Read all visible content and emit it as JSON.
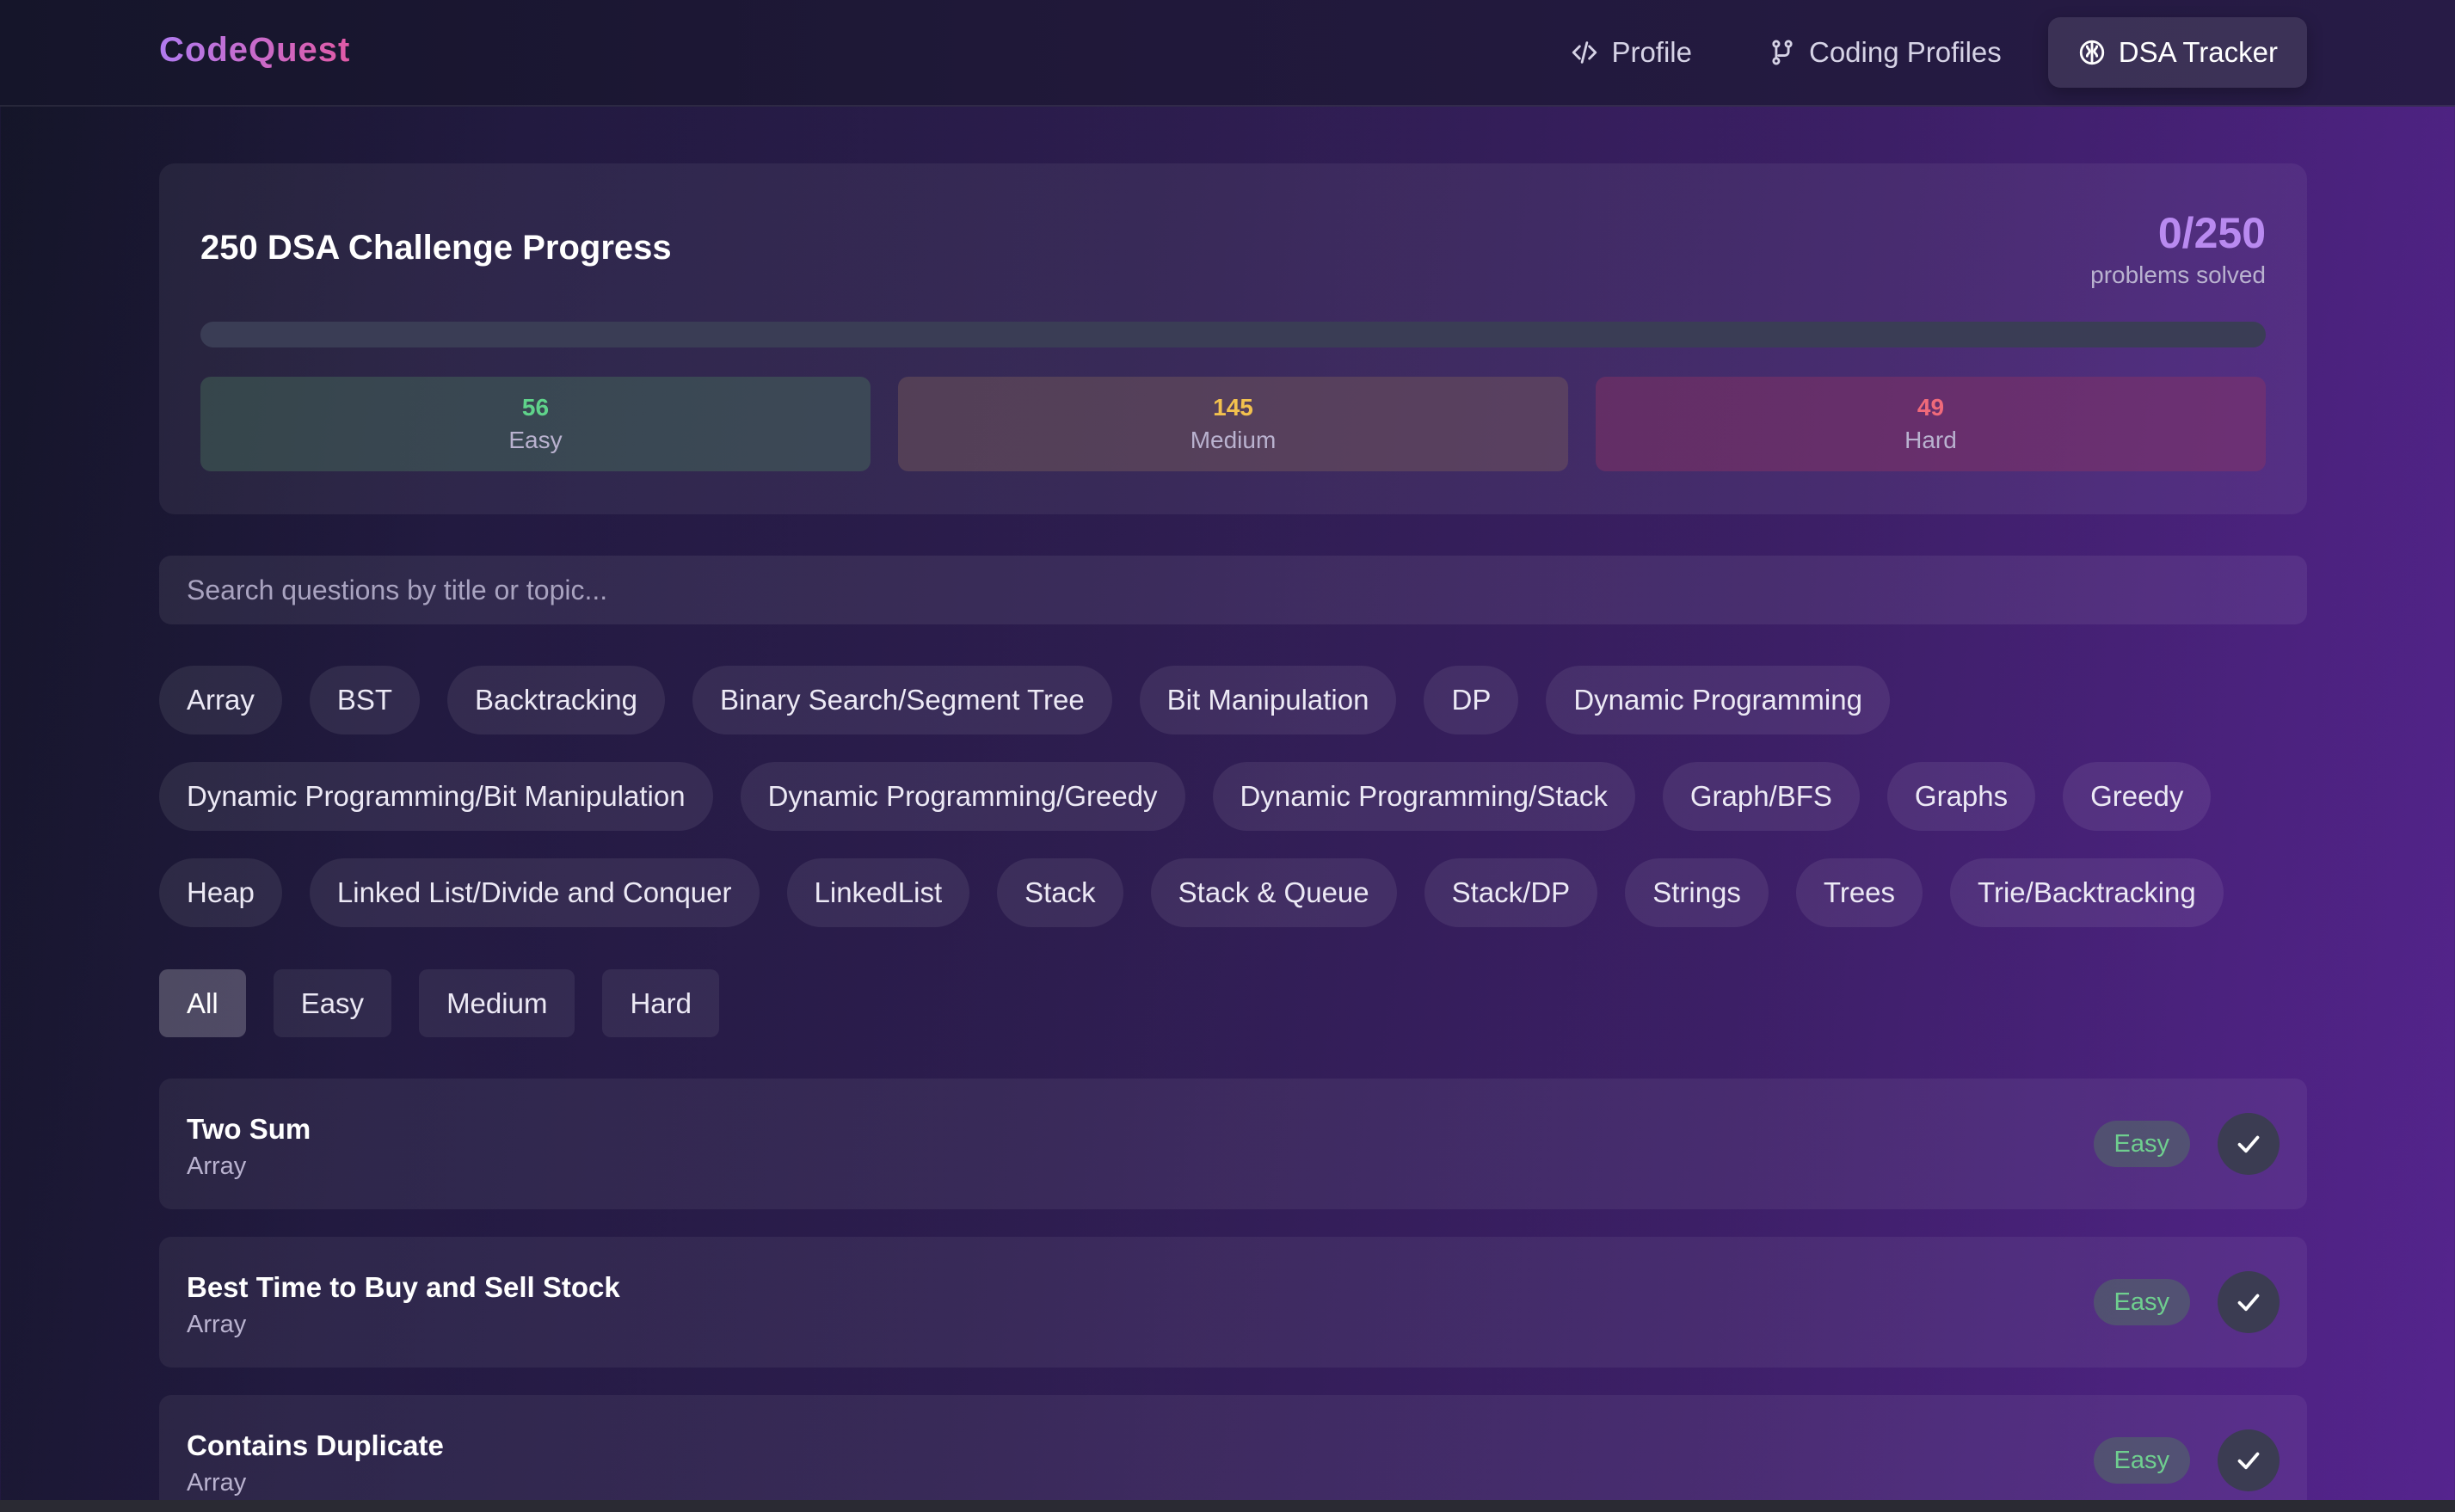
{
  "header": {
    "brand": "CodeQuest",
    "nav": [
      {
        "label": "Profile",
        "icon": "code-icon"
      },
      {
        "label": "Coding Profiles",
        "icon": "network-icon"
      },
      {
        "label": "DSA Tracker",
        "icon": "brain-icon"
      }
    ]
  },
  "progress": {
    "title": "250 DSA Challenge Progress",
    "count": "0/250",
    "subtitle": "problems solved",
    "fraction_complete": 0,
    "easy": {
      "count": "56",
      "label": "Easy"
    },
    "medium": {
      "count": "145",
      "label": "Medium"
    },
    "hard": {
      "count": "49",
      "label": "Hard"
    }
  },
  "search": {
    "placeholder": "Search questions by title or topic..."
  },
  "topics": [
    "Array",
    "BST",
    "Backtracking",
    "Binary Search/Segment Tree",
    "Bit Manipulation",
    "DP",
    "Dynamic Programming",
    "Dynamic Programming/Bit Manipulation",
    "Dynamic Programming/Greedy",
    "Dynamic Programming/Stack",
    "Graph/BFS",
    "Graphs",
    "Greedy",
    "Heap",
    "Linked List/Divide and Conquer",
    "LinkedList",
    "Stack",
    "Stack & Queue",
    "Stack/DP",
    "Strings",
    "Trees",
    "Trie/Backtracking"
  ],
  "filters": [
    "All",
    "Easy",
    "Medium",
    "Hard"
  ],
  "questions": [
    {
      "title": "Two Sum",
      "topic": "Array",
      "difficulty": "Easy"
    },
    {
      "title": "Best Time to Buy and Sell Stock",
      "topic": "Array",
      "difficulty": "Easy"
    },
    {
      "title": "Contains Duplicate",
      "topic": "Array",
      "difficulty": "Easy"
    }
  ],
  "colors": {
    "accent": "#b98af0",
    "easy": "#5fd38a",
    "medium": "#f2c14e",
    "hard": "#f06a7a"
  }
}
